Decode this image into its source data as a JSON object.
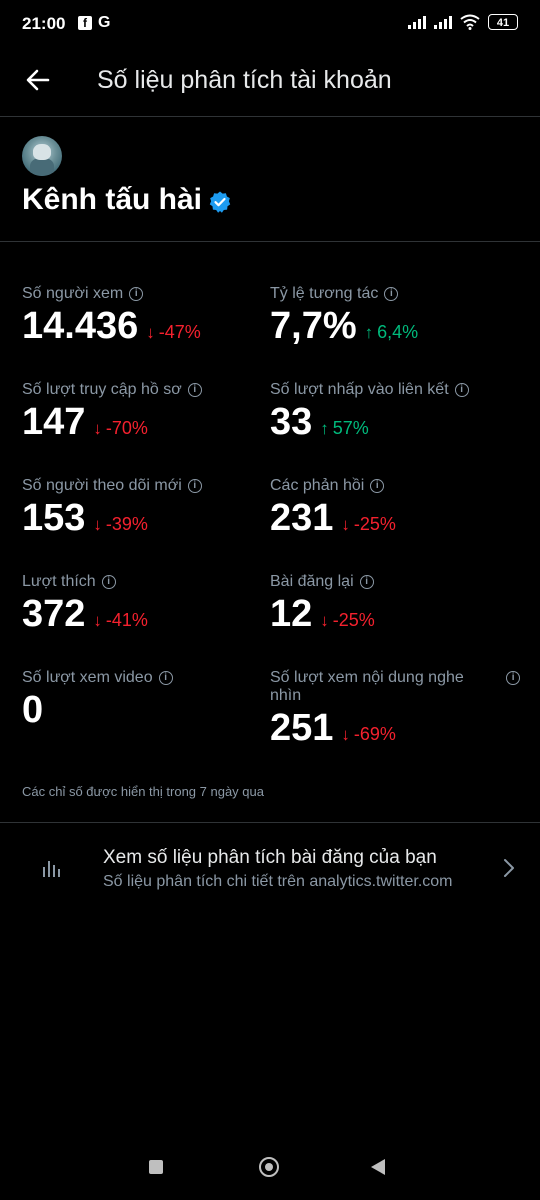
{
  "status_bar": {
    "time": "21:00",
    "app_icons": [
      "facebook-icon",
      "google-icon"
    ],
    "battery": "41"
  },
  "header": {
    "title": "Số liệu phân tích tài khoản"
  },
  "profile": {
    "name": "Kênh tấu hài",
    "verified": true
  },
  "metrics": [
    {
      "label": "Số người xem",
      "value": "14.436",
      "change": "-47%",
      "direction": "down"
    },
    {
      "label": "Tỷ lệ tương tác",
      "value": "7,7%",
      "change": "6,4%",
      "direction": "up"
    },
    {
      "label": "Số lượt truy cập hồ sơ",
      "value": "147",
      "change": "-70%",
      "direction": "down"
    },
    {
      "label": "Số lượt nhấp vào liên kết",
      "value": "33",
      "change": "57%",
      "direction": "up"
    },
    {
      "label": "Số người theo dõi mới",
      "value": "153",
      "change": "-39%",
      "direction": "down"
    },
    {
      "label": "Các phản hồi",
      "value": "231",
      "change": "-25%",
      "direction": "down"
    },
    {
      "label": "Lượt thích",
      "value": "372",
      "change": "-41%",
      "direction": "down"
    },
    {
      "label": "Bài đăng lại",
      "value": "12",
      "change": "-25%",
      "direction": "down"
    },
    {
      "label": "Số lượt xem video",
      "value": "0",
      "change": "",
      "direction": ""
    },
    {
      "label": "Số lượt xem nội dung nghe nhìn",
      "value": "251",
      "change": "-69%",
      "direction": "down"
    }
  ],
  "footnote": "Các chỉ số được hiển thị trong 7 ngày qua",
  "post_analytics": {
    "title": "Xem số liệu phân tích bài đăng của bạn",
    "subtitle": "Số liệu phân tích chi tiết trên analytics.twitter.com"
  },
  "colors": {
    "background": "#000000",
    "negative": "#f4212e",
    "positive": "#00ba7c",
    "verified": "#1d9bf0",
    "muted_text": "#8b98a5"
  }
}
